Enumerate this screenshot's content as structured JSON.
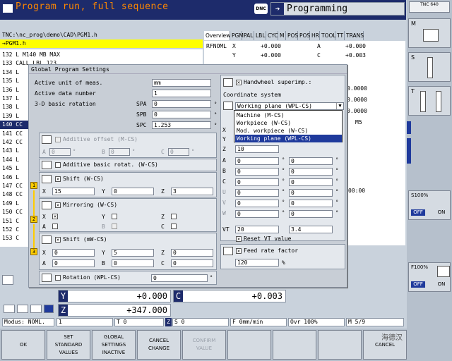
{
  "header": {
    "mode_left": "Program run, full sequence",
    "dnc_label": "DNC",
    "mode_right": "Programming",
    "logo_text": "TNC 640"
  },
  "program": {
    "path": "TNC:\\nc_prog\\demo\\CAD\\PGM1.h",
    "selected": "→PGM1.h",
    "lines": [
      "132 L M140 MB MAX",
      "133 CALL LBL 123",
      "134 L",
      "135 L",
      "136 L",
      "137 L",
      "138 L",
      "139 L",
      "140 CC",
      "141 CC",
      "142 CC",
      "143 L",
      "144 L",
      "145 L",
      "146 L",
      "147 CC",
      "148 CC",
      "149 L",
      "150 CC",
      "151 C",
      "152 C",
      "153 C"
    ],
    "current_index": 8
  },
  "status": {
    "tabs": [
      "Overview",
      "PGM",
      "PAL",
      "LBL",
      "CYC",
      "M",
      "POS",
      "POS",
      "HR",
      "TOOL",
      "TT",
      "TRANS"
    ],
    "active_tab": 0,
    "rfnoml": "RFNOML",
    "row1": [
      "X",
      "+0.000",
      "A",
      "+0.000"
    ],
    "row2": [
      "Y",
      "+0.000",
      "C",
      "+0.003"
    ],
    "val_a": "0.0000",
    "val_b": "0.0000",
    "val_c": "0.0000",
    "m5": "M5",
    "time": "00:00"
  },
  "dialog": {
    "title": "Global Program Settings",
    "unit_label": "Active unit of meas.",
    "unit_value": "mm",
    "datum_label": "Active data number",
    "datum_value": "1",
    "rot_label": "3-D basic rotation",
    "spa_label": "SPA",
    "spa_value": "0",
    "spb_label": "SPB",
    "spb_value": "0",
    "spc_label": "SPC",
    "spc_value": "1.253",
    "add_offset_label": "Additive offset (M-CS)",
    "ao_a": "0",
    "ao_b": "0",
    "ao_c": "0",
    "add_basic_label": "Additive basic rotat. (W-CS)",
    "shift_w_label": "Shift (W-CS)",
    "shift_x": "15",
    "shift_y": "0",
    "shift_z": "3",
    "mirror_label": "Mirroring (W-CS)",
    "shift_mw_label": "Shift (mW-CS)",
    "smw_x": "0",
    "smw_y": "5",
    "smw_z": "0",
    "smw_a": "0",
    "smw_b": "0",
    "smw_c": "0",
    "rotation_label": "Rotation (WPL-CS)",
    "rotation_value": "0",
    "handwheel_label": "Handwheel superimp.:",
    "coord_label": "Coordinate system",
    "coord_value": "Working plane (WPL-CS)",
    "coord_options": [
      "Machine (M-CS)",
      "Workpiece (W-CS)",
      "Mod. workpiece (W-CS)",
      "Working plane (WPL-CS)"
    ],
    "hw_z": "10",
    "hw_rows": [
      {
        "axis": "A",
        "v1": "0",
        "v2": "0"
      },
      {
        "axis": "B",
        "v1": "0",
        "v2": "0"
      },
      {
        "axis": "C",
        "v1": "0",
        "v2": "0"
      },
      {
        "axis": "U",
        "v1": "0",
        "v2": "0"
      },
      {
        "axis": "V",
        "v1": "0",
        "v2": "0"
      },
      {
        "axis": "W",
        "v1": "0",
        "v2": "0"
      }
    ],
    "vt_label": "VT",
    "vt_v1": "20",
    "vt_v2": "3.4",
    "reset_vt_label": "Reset VT value",
    "feed_label": "Feed rate factor",
    "feed_value": "120",
    "feed_unit": "%",
    "x": "X",
    "y": "Y",
    "z": "Z",
    "a": "A",
    "b": "B",
    "c": "C",
    "deg": "°",
    "step1": "1",
    "step2": "2",
    "step3": "3"
  },
  "position": {
    "y_label": "Y",
    "y_value": "+0.000",
    "c_label": "C",
    "c_value": "+0.003",
    "z_label": "Z",
    "z_value": "+347.000"
  },
  "statusbar": {
    "mode": "Modus: NOML.",
    "t": "T 0",
    "s": "S 0",
    "f": "F 0mm/min",
    "ovr": "Ovr 100%",
    "m": "M 5/9",
    "z_icon": "Z",
    "num": "1"
  },
  "softkeys": [
    {
      "label": "OK",
      "enabled": true
    },
    {
      "label": "SET\nSTANDARD\nVALUES",
      "enabled": true
    },
    {
      "label": "GLOBAL\nSETTINGS\nINACTIVE",
      "enabled": true
    },
    {
      "label": "CANCEL\nCHANGE",
      "enabled": true
    },
    {
      "label": "CONFIRM\nVALUE",
      "enabled": false
    },
    {
      "label": "",
      "enabled": true
    },
    {
      "label": "",
      "enabled": true
    },
    {
      "label": "",
      "enabled": true
    },
    {
      "label": "CANCEL",
      "enabled": true
    }
  ],
  "rightkeys": {
    "m": "M",
    "s": "S",
    "t": "T",
    "s100": "S100%",
    "f100": "F100%",
    "off1": "OFF",
    "on1": "ON",
    "off2": "OFF",
    "on2": "ON"
  },
  "watermark": "海德汉"
}
